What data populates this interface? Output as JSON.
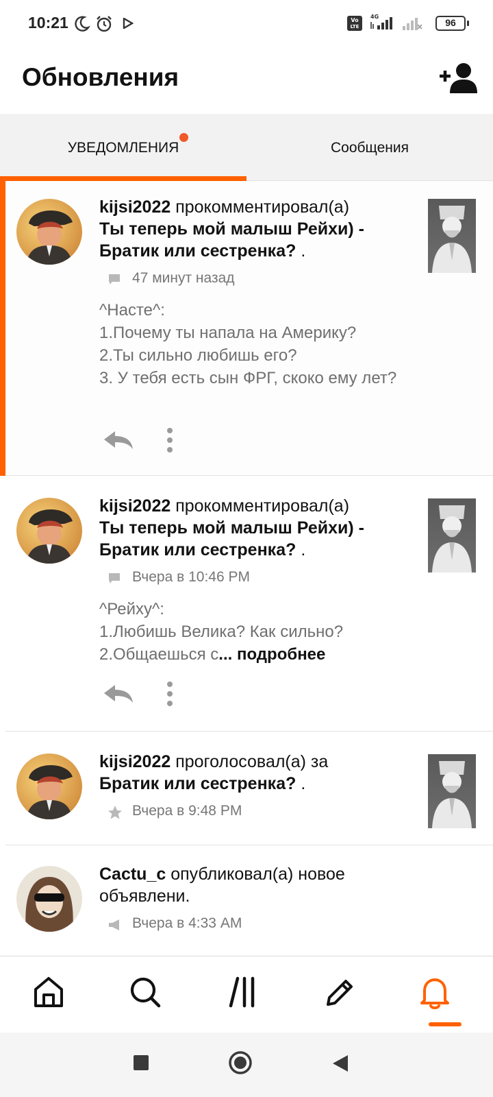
{
  "status_bar": {
    "time": "10:21",
    "battery": "96",
    "network": "4G"
  },
  "header": {
    "title": "Обновления"
  },
  "tabs": [
    {
      "label": "УВЕДОМЛЕНИЯ",
      "active": true,
      "has_badge": true
    },
    {
      "label": "Сообщения",
      "active": false,
      "has_badge": false
    }
  ],
  "notifications": [
    {
      "username": "kijsi2022",
      "action": " прокомментировал(а)",
      "story": "Ты теперь мой малыш Рейхи) - Братик или сестренка?",
      "suffix": " .",
      "time": "47 минут назад",
      "meta_icon": "comment-icon",
      "body": "^Насте^:\n1.Почему ты напала на Америку?\n2.Ты сильно любишь его?\n3. У тебя есть сын ФРГ, скоко ему лет?",
      "more": "",
      "unread": true
    },
    {
      "username": "kijsi2022",
      "action": " прокомментировал(а)",
      "story": "Ты теперь мой малыш Рейхи) - Братик или сестренка?",
      "suffix": " .",
      "time": "Вчера в 10:46 PM",
      "meta_icon": "comment-icon",
      "body": "^Рейху^:\n1.Любишь Велика? Как сильно?\n2.Общаешься с",
      "more": "... подробнее",
      "unread": false
    },
    {
      "username": "kijsi2022",
      "action": " проголосовал(а) за",
      "story": "Братик или сестренка?",
      "suffix": " .",
      "time": "Вчера в 9:48 PM",
      "meta_icon": "star-icon",
      "body": "",
      "more": "",
      "unread": false
    },
    {
      "username": "Cactu_c",
      "action": " опубликовал(а) новое объявлени.",
      "story": "",
      "suffix": "",
      "time": "Вчера в 4:33 AM",
      "meta_icon": "megaphone-icon",
      "body": "",
      "more": "",
      "unread": false
    }
  ],
  "bottom_nav": [
    {
      "icon": "home-icon",
      "active": false
    },
    {
      "icon": "search-icon",
      "active": false
    },
    {
      "icon": "library-icon",
      "active": false
    },
    {
      "icon": "pencil-icon",
      "active": false
    },
    {
      "icon": "bell-icon",
      "active": true
    }
  ],
  "colors": {
    "accent": "#ff6100",
    "badge": "#f05a2a",
    "text": "#121212",
    "muted": "#767676"
  }
}
